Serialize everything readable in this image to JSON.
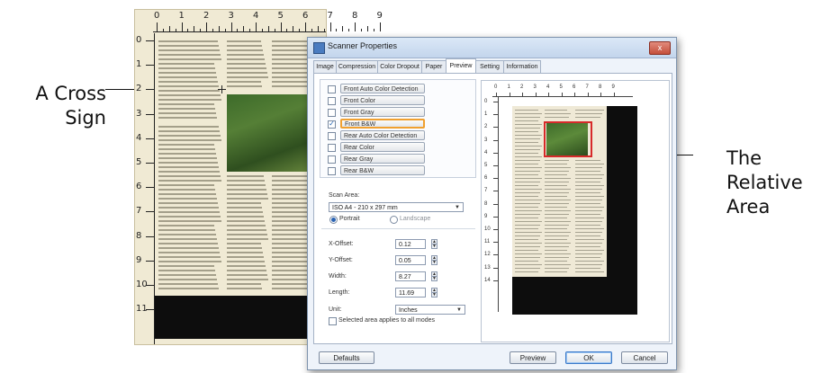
{
  "annotations": {
    "cross_sign": [
      "A Cross",
      "Sign"
    ],
    "relative_area": [
      "The",
      "Relative",
      "Area"
    ]
  },
  "paper": {
    "top_ruler": [
      "0",
      "1",
      "2",
      "3",
      "4",
      "5",
      "6",
      "7",
      "8",
      "9"
    ],
    "left_ruler": [
      "0",
      "1",
      "2",
      "3",
      "4",
      "5",
      "6",
      "7",
      "8",
      "9",
      "10",
      "11"
    ]
  },
  "dialog": {
    "title": "Scanner Properties",
    "close_label": "x",
    "tabs": [
      "Image",
      "Compression",
      "Color Dropout",
      "Paper",
      "Preview",
      "Setting",
      "Information"
    ],
    "active_tab": "Preview",
    "modes": [
      {
        "label": "Front Auto Color Detection",
        "checked": false
      },
      {
        "label": "Front Color",
        "checked": false
      },
      {
        "label": "Front Gray",
        "checked": false
      },
      {
        "label": "Front B&W",
        "checked": true
      },
      {
        "label": "Rear Auto Color Detection",
        "checked": false
      },
      {
        "label": "Rear Color",
        "checked": false
      },
      {
        "label": "Rear Gray",
        "checked": false
      },
      {
        "label": "Rear B&W",
        "checked": false
      }
    ],
    "scan_area_label": "Scan Area:",
    "scan_area_value": "ISO A4 - 210 x 297 mm",
    "orientation": {
      "portrait": "Portrait",
      "landscape": "Landscape",
      "selected": "Portrait"
    },
    "fields": [
      {
        "label": "X-Offset:",
        "value": "0.12"
      },
      {
        "label": "Y-Offset:",
        "value": "0.05"
      },
      {
        "label": "Width:",
        "value": "8.27"
      },
      {
        "label": "Length:",
        "value": "11.69"
      }
    ],
    "unit_label": "Unit:",
    "unit_value": "Inches",
    "apply_all_label": "Selected area applies to all modes",
    "buttons": {
      "defaults": "Defaults",
      "preview": "Preview",
      "ok": "OK",
      "cancel": "Cancel"
    },
    "preview_top_ruler": [
      "0",
      "1",
      "2",
      "3",
      "4",
      "5",
      "6",
      "7",
      "8",
      "9"
    ],
    "preview_left_ruler": [
      "0",
      "1",
      "2",
      "3",
      "4",
      "5",
      "6",
      "7",
      "8",
      "9",
      "10",
      "11",
      "12",
      "13",
      "14"
    ]
  },
  "colors": {
    "selection_frame": "#d72a2a",
    "selected_mode_outline": "#f0a030",
    "scanner_background": "#0d0d0d"
  }
}
